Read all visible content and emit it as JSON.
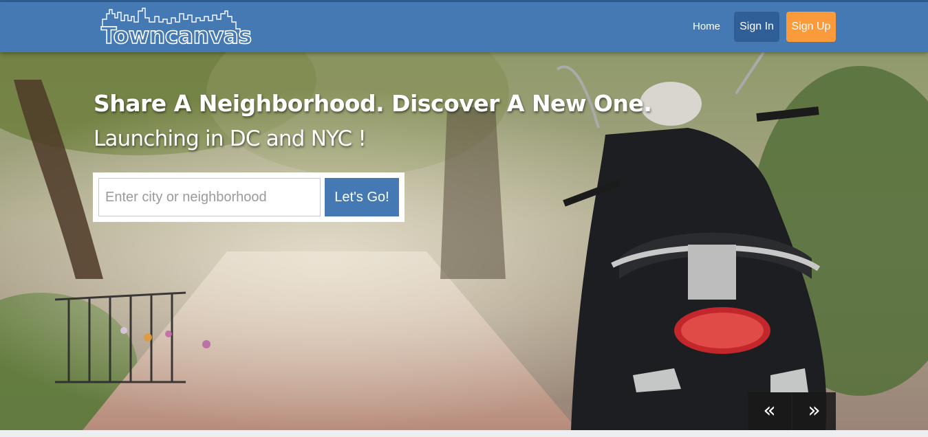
{
  "header": {
    "logo_text": "Towncanvas",
    "nav": {
      "home": "Home",
      "sign_in": "Sign In",
      "sign_up": "Sign Up"
    }
  },
  "hero": {
    "headline": "Share A Neighborhood. Discover A New One.",
    "subhead": "Launching in DC and NYC !",
    "search": {
      "placeholder": "Enter city or neighborhood",
      "value": "",
      "button_label": "Let's Go!"
    },
    "carousel": {
      "prev_label": "«",
      "next_label": "»"
    }
  },
  "colors": {
    "brand_blue": "#4479b3",
    "dark_blue": "#2f5f96",
    "accent_orange": "#fb9a3a"
  }
}
